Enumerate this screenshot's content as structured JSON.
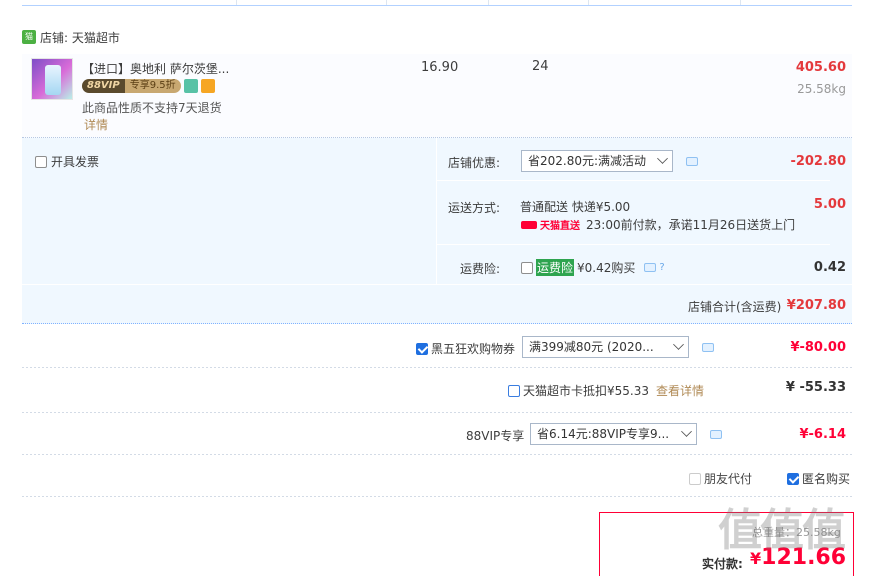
{
  "shop": {
    "name": "店铺: 天猫超市"
  },
  "item": {
    "title": "【进口】奥地利 萨尔茨堡...",
    "vip_badge_left": "88VIP",
    "vip_badge_right": "专享9.5折",
    "no_return_note": "此商品性质不支持7天退货",
    "detail_link": "详情",
    "unit_price": "16.90",
    "quantity": "24",
    "subtotal": "405.60",
    "weight": "25.58kg"
  },
  "invoice": {
    "label": "开具发票"
  },
  "shop_discount": {
    "label": "店铺优惠:",
    "selected": "省202.80元:满减活动",
    "amount": "-202.80"
  },
  "shipping": {
    "label": "运送方式:",
    "method": "普通配送 快递¥5.00",
    "amount": "5.00",
    "tmall_tag": "天猫直送",
    "promise": "23:00前付款，承诺11月26日送货上门"
  },
  "insurance": {
    "label": "运费险:",
    "tag": "运费险",
    "price_text": "¥0.42购买",
    "amount": "0.42"
  },
  "shop_total": {
    "label": "店铺合计(含运费)",
    "amount": "¥207.80"
  },
  "coupon": {
    "label": "黑五狂欢购物券",
    "selected": "满399减80元 (2020...",
    "amount": "¥-80.00"
  },
  "card": {
    "label": "天猫超市卡抵扣¥55.33",
    "link": "查看详情",
    "amount": "¥ -55.33"
  },
  "vip": {
    "label": "88VIP专享",
    "selected": "省6.14元:88VIP专享9...",
    "amount": "¥-6.14"
  },
  "options": {
    "friend_pay": "朋友代付",
    "anonymous": "匿名购买"
  },
  "final": {
    "weight_label": "总重量：25.58kg",
    "pay_label": "实付款:",
    "currency": "¥",
    "amount": "121.66"
  },
  "watermark": "值值值"
}
